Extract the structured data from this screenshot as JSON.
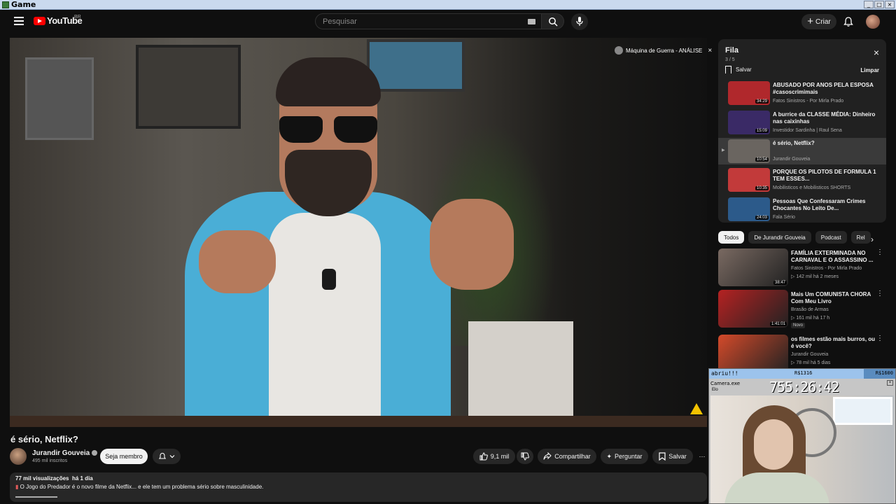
{
  "window": {
    "title": "Game"
  },
  "header": {
    "logo_text": "YouTube",
    "country": "BR",
    "search_placeholder": "Pesquisar",
    "create_label": "Criar"
  },
  "player": {
    "queue_overlay_title": "Máquina de Guerra - ANÁLISE"
  },
  "video": {
    "title": "é sério, Netflix?",
    "channel": "Jurandir Gouveia",
    "subscribers": "495 mil inscritos",
    "join_label": "Seja membro",
    "likes": "9,1 mil",
    "share_label": "Compartilhar",
    "ask_label": "Perguntar",
    "save_label": "Salvar",
    "more_label": "···",
    "views": "77 mil visualizações",
    "age": "há 1 dia",
    "description": "O Jogo do Predador é o novo filme da Netflix... e ele tem um problema sério sobre masculinidade."
  },
  "queue": {
    "title": "Fila",
    "count": "3 / 5",
    "save_label": "Salvar",
    "clear_label": "Limpar",
    "items": [
      {
        "title": "ABUSADO POR ANOS PELA ESPOSA #casoscrimimais",
        "channel": "Fatos Sinistros - Por Mirla Prado",
        "duration": "34:29",
        "thumb_color": "#b0282c"
      },
      {
        "title": "A burrice da CLASSE MÉDIA: Dinheiro nas caixinhas",
        "channel": "Investidor Sardinha | Raul Sena",
        "duration": "15:09",
        "thumb_color": "#3a2a66"
      },
      {
        "title": "é sério, Netflix?",
        "channel": "Jurandir Gouveia",
        "duration": "10:54",
        "thumb_color": "#6a6560"
      },
      {
        "title": "PORQUE OS PILOTOS DE FORMULA 1 TEM ESSES...",
        "channel": "Mobilisticos e Mobilisticos SHORTS",
        "duration": "10:35",
        "thumb_color": "#c23a3a"
      },
      {
        "title": "Pessoas Que Confessaram Crimes Chocantes No Leito De...",
        "channel": "Fala Sério",
        "duration": "24:03",
        "thumb_color": "#2c5a8a"
      }
    ]
  },
  "chips": [
    "Todos",
    "De Jurandir Gouveia",
    "Podcast",
    "Rel"
  ],
  "recommendations": [
    {
      "title": "FAMÍLIA EXTERMINADA NO CARNAVAL E O ASSASSINO ...",
      "channel": "Fatos Sinistros - Por Mirla Prado",
      "meta": "142 mil há 2 meses",
      "duration": "38:47",
      "badge": "",
      "thumb_color": "#7a6a62"
    },
    {
      "title": "Mais Um COMUNISTA CHORA Com Meu Livro",
      "channel": "Brasão de Armas",
      "meta": "161 mil há 17 h",
      "duration": "1:41:01",
      "badge": "Novo",
      "thumb_color": "#b52222"
    },
    {
      "title": "os filmes estão mais burros, ou é você?",
      "channel": "Jurandir Gouveia",
      "meta": "78 mil há 5 dias",
      "duration": "",
      "badge": "",
      "thumb_color": "#d44a2a"
    }
  ],
  "overlay": {
    "goal_text": "abriu!!!",
    "goal_mid": "R$1316",
    "goal_max": "R$1600",
    "goal_progress": 0.83,
    "cam_title": "Camera.exe",
    "cam_sub": "Elo",
    "timer": "755:26:42"
  },
  "colors": {
    "accent": "#ff0000",
    "background": "#0f0f0f",
    "panel": "#212121",
    "chip": "#272727"
  }
}
